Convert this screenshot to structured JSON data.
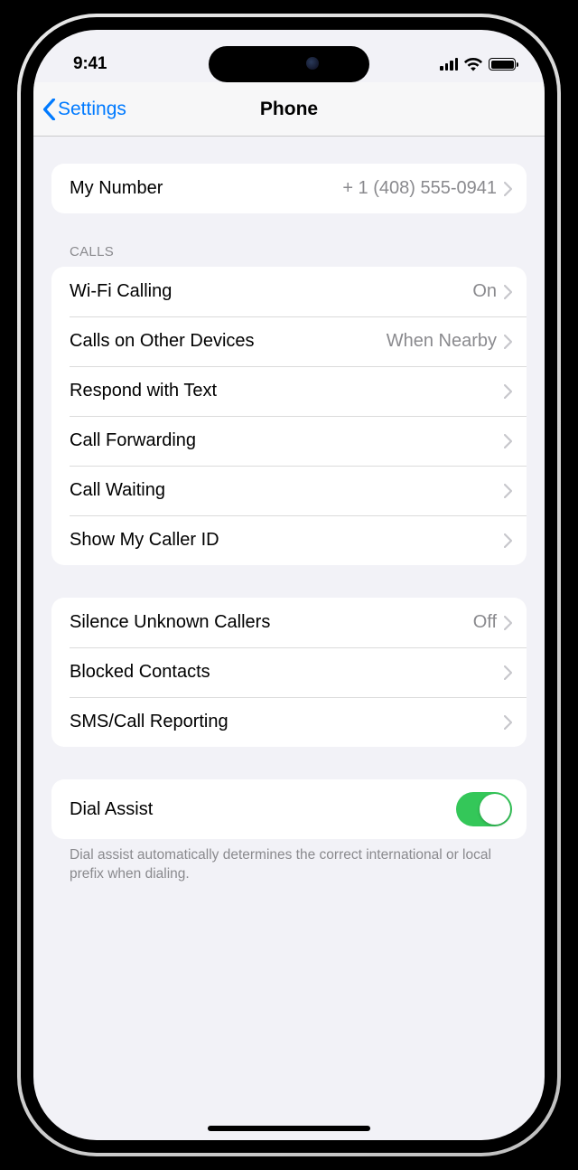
{
  "status": {
    "time": "9:41"
  },
  "nav": {
    "back_label": "Settings",
    "title": "Phone"
  },
  "groups": {
    "my_number": {
      "label": "My Number",
      "value": "+ 1 (408) 555-0941"
    },
    "calls_header": "CALLS",
    "calls": [
      {
        "label": "Wi-Fi Calling",
        "value": "On"
      },
      {
        "label": "Calls on Other Devices",
        "value": "When Nearby"
      },
      {
        "label": "Respond with Text",
        "value": ""
      },
      {
        "label": "Call Forwarding",
        "value": ""
      },
      {
        "label": "Call Waiting",
        "value": ""
      },
      {
        "label": "Show My Caller ID",
        "value": ""
      }
    ],
    "blocking": [
      {
        "label": "Silence Unknown Callers",
        "value": "Off"
      },
      {
        "label": "Blocked Contacts",
        "value": ""
      },
      {
        "label": "SMS/Call Reporting",
        "value": ""
      }
    ],
    "dial_assist": {
      "label": "Dial Assist",
      "enabled": true,
      "footer": "Dial assist automatically determines the correct international or local prefix when dialing."
    }
  }
}
